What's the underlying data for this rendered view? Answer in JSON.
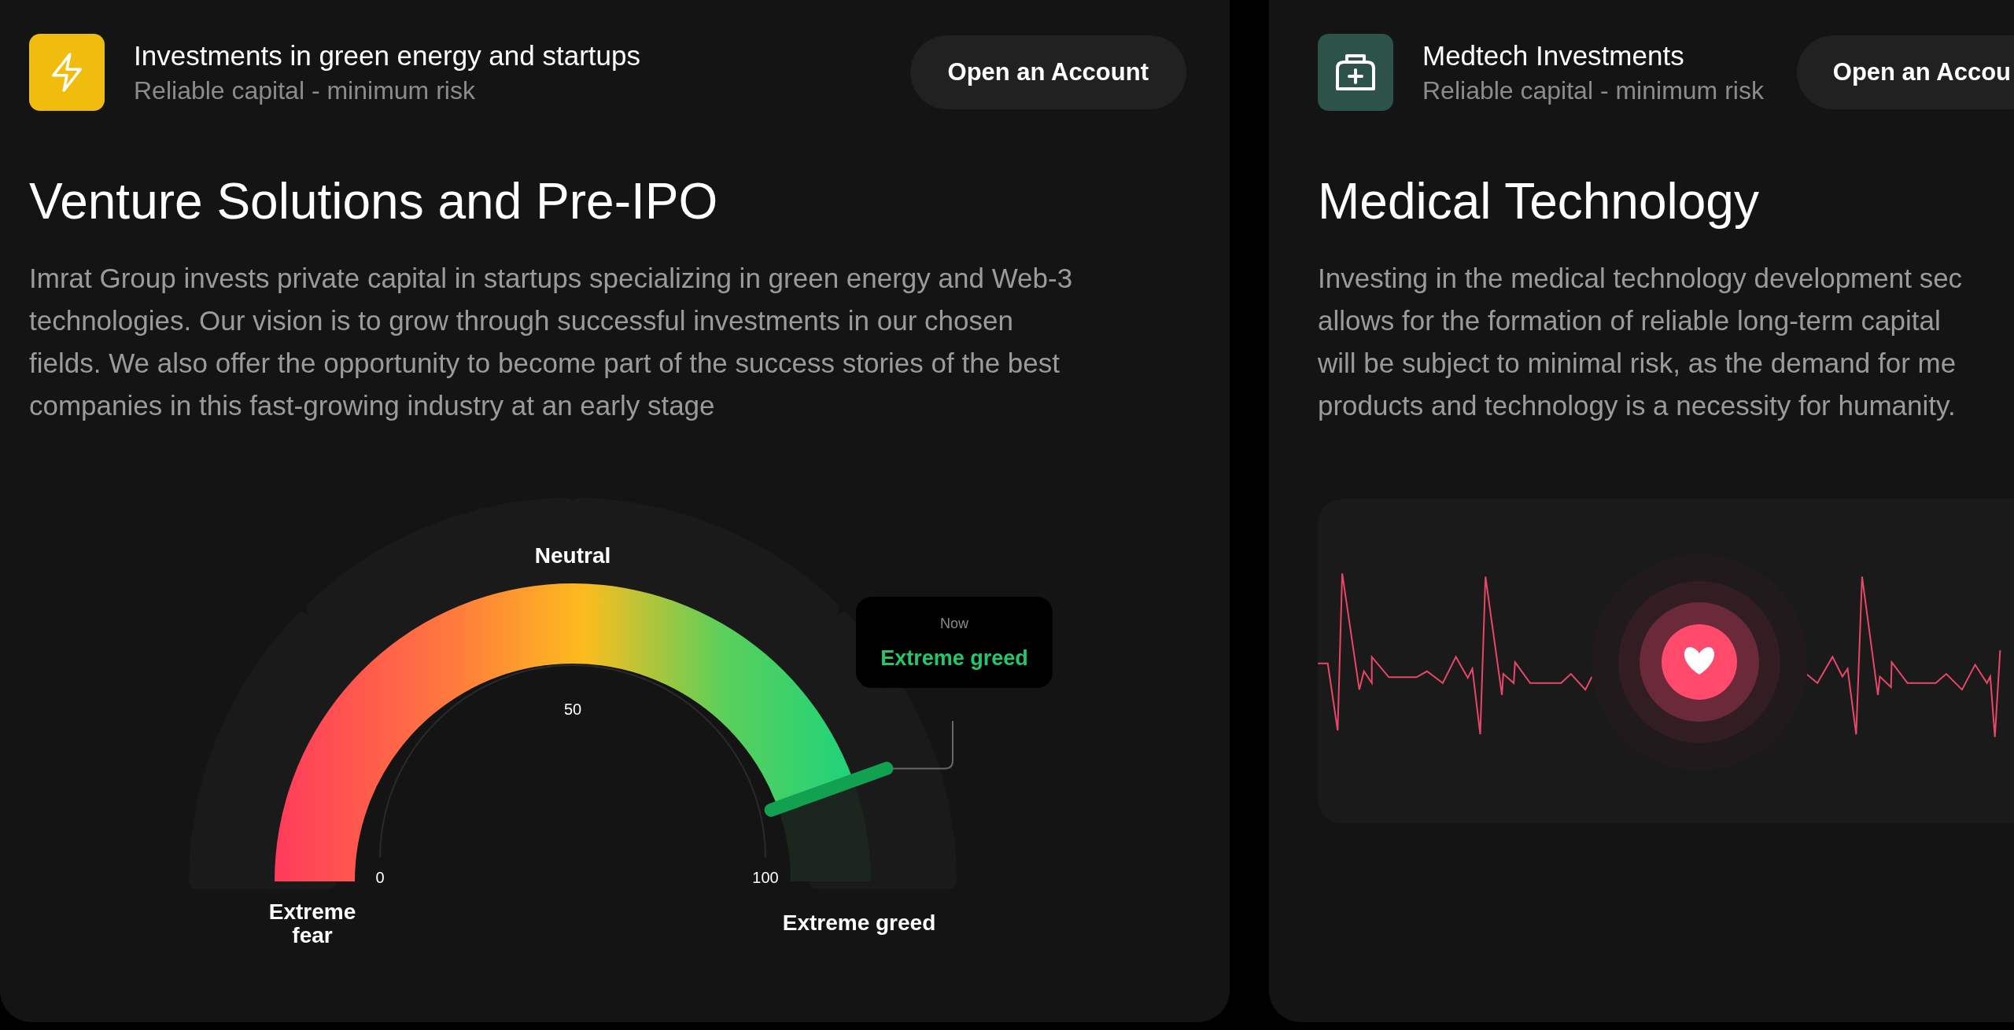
{
  "cards": [
    {
      "kind": "gauge",
      "title": "Investments in green energy and startups",
      "subtitle": "Reliable capital - minimum risk",
      "button": "Open an Account",
      "heading": "Venture Solutions and Pre-IPO",
      "description_lines": [
        "Imrat Group invests private capital in startups specializing in green energy and Web-3",
        "technologies. Our vision is to grow through successful investments in our chosen",
        "fields. We also offer the opportunity to become part of the success stories of the best",
        "companies in this fast-growing industry at an early stage"
      ],
      "gauge": {
        "top_label": "Neutral",
        "scale_labels": [
          "0",
          "50",
          "100"
        ],
        "min_label": "Extreme fear",
        "max_label": "Extreme greed",
        "level": 0.89,
        "tooltip": {
          "caption": "Now",
          "value": "Extreme greed"
        }
      }
    },
    {
      "kind": "heartbeat",
      "title": "Medtech Investments",
      "subtitle": "Reliable capital - minimum risk",
      "button": "Open an Accou",
      "heading": "Medical Technology",
      "description_lines": [
        "Investing in the medical technology development sec",
        "allows for the formation of reliable long-term capital",
        "will be subject to minimal risk, as the demand for me",
        "products and technology is a necessity for humanity."
      ]
    }
  ]
}
